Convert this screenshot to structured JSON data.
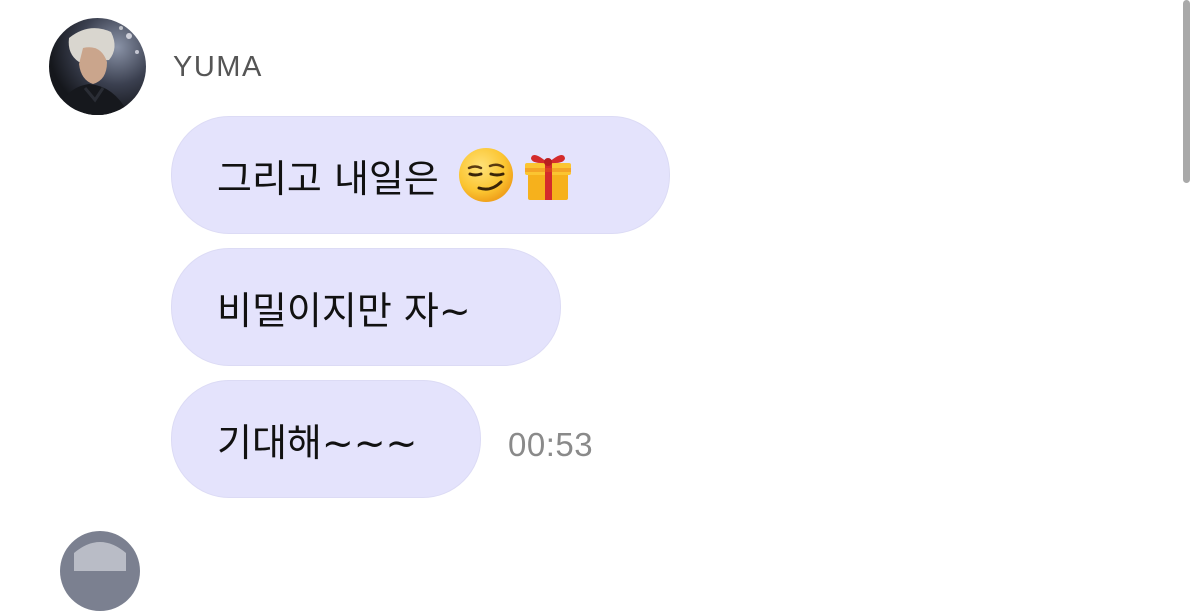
{
  "message_group": {
    "sender": {
      "name": "YUMA",
      "avatar_icon": "profile-photo"
    },
    "messages": [
      {
        "text": "그리고 내일은",
        "emojis": [
          "smirking-face-emoji",
          "wrapped-gift-emoji"
        ]
      },
      {
        "text": "비밀이지만 자~"
      },
      {
        "text": "기대해~~~",
        "time": "00:53"
      }
    ]
  },
  "colors": {
    "bubble_background": "#e4e3fc",
    "timestamp_text": "#8a8a8a",
    "sender_name_text": "#555555"
  }
}
